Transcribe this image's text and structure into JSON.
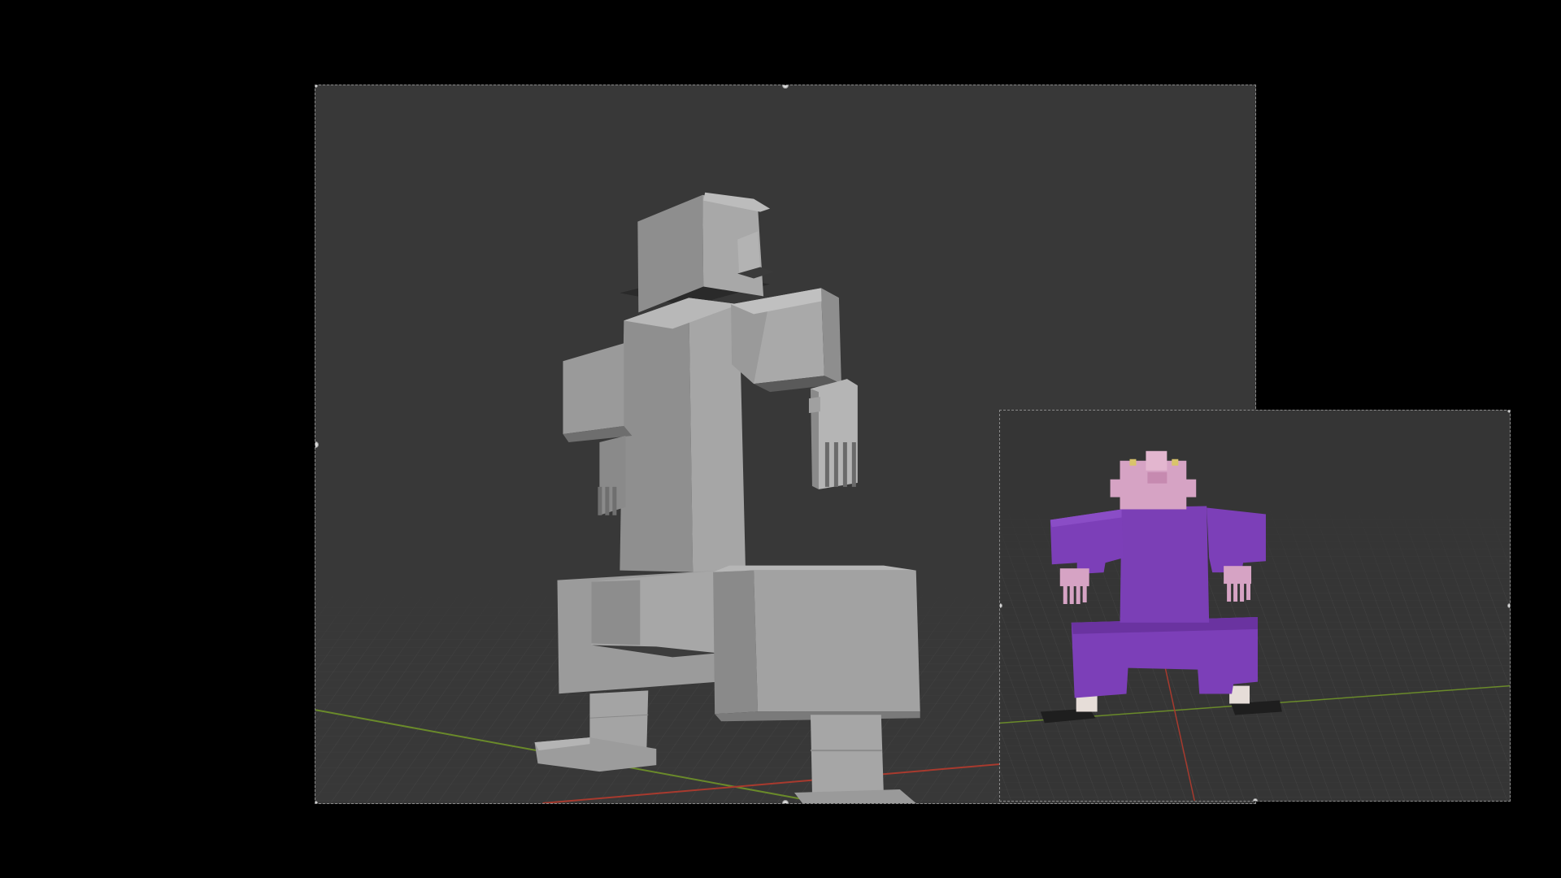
{
  "window": {
    "background": "#000000"
  },
  "main_viewport": {
    "view": "solid-shading",
    "object": "blocky-character-model",
    "background": "#383838",
    "model_color": "#9a9a9a",
    "axis_x_color": "#c0392b",
    "axis_y_color": "#6a8a2a"
  },
  "inset_viewport": {
    "view": "material-preview",
    "object": "blocky-character-model",
    "background": "#353535",
    "colors": {
      "body": "#7a3fb5",
      "skin": "#d6a3c4",
      "hair": "#d9c46a",
      "shoes": "#1e1e1e",
      "socks": "#e8e0dc"
    }
  }
}
